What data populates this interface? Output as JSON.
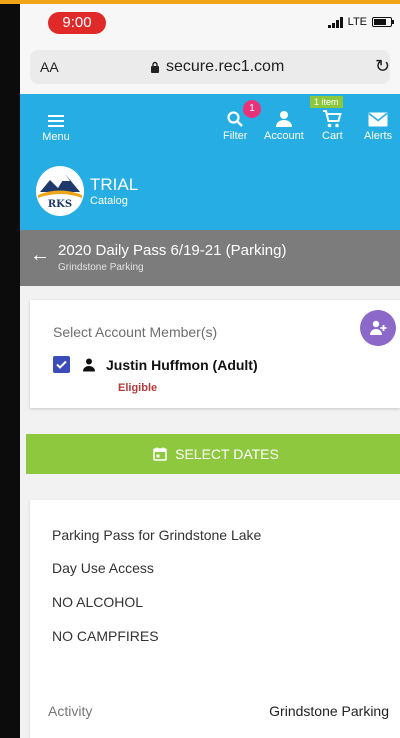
{
  "status_bar": {
    "time": "9:00",
    "network": "LTE"
  },
  "browser": {
    "aa_label": "AA",
    "url": "secure.rec1.com"
  },
  "nav": {
    "menu": "Menu",
    "filter": "Filter",
    "filter_badge": "1",
    "account": "Account",
    "cart": "Cart",
    "cart_badge": "1 item",
    "alerts": "Alerts"
  },
  "brand": {
    "logo_text": "RKS",
    "title": "TRIAL",
    "subtitle": "Catalog"
  },
  "page": {
    "title": "2020 Daily Pass 6/19-21 (Parking)",
    "subtitle": "Grindstone Parking"
  },
  "member": {
    "label": "Select Account Member(s)",
    "name": "Justin Huffmon (Adult)",
    "status": "Eligible"
  },
  "select_dates": "SELECT DATES",
  "details": {
    "lines": [
      "Parking Pass for Grindstone Lake",
      "Day Use Access",
      "NO ALCOHOL",
      "NO CAMPFIRES"
    ],
    "activity_label": "Activity",
    "activity_value": "Grindstone Parking"
  },
  "colors": {
    "header": "#26aee4",
    "page_header": "#7c7c7c",
    "select_dates": "#8ec83f",
    "add_member": "#8c69c9",
    "eligible": "#b23a3a",
    "badge": "#e8327a"
  }
}
